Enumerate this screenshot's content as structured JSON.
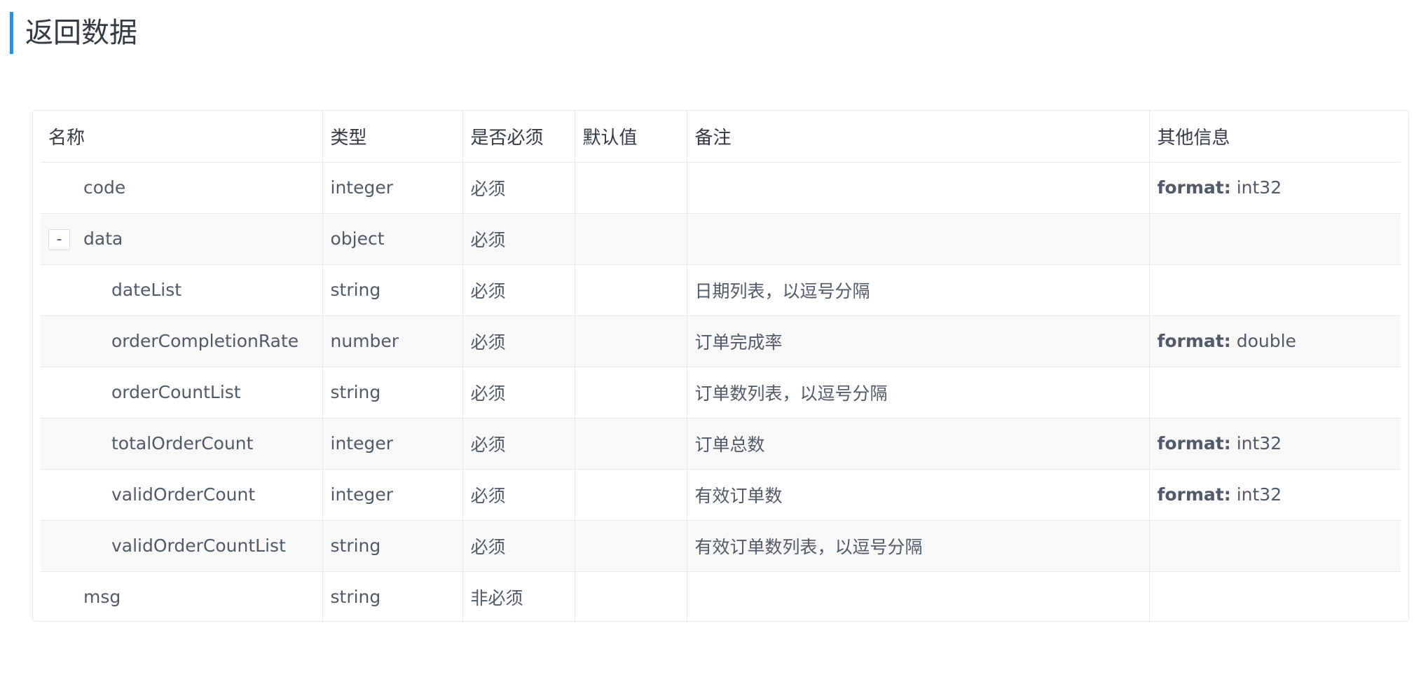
{
  "section": {
    "title": "返回数据"
  },
  "table": {
    "headers": {
      "name": "名称",
      "type": "类型",
      "required": "是否必须",
      "default": "默认值",
      "remark": "备注",
      "other": "其他信息"
    },
    "collapse_label": "-",
    "format_key": "format:",
    "rows": [
      {
        "name": "code",
        "type": "integer",
        "required": "必须",
        "default": "",
        "remark": "",
        "format": "int32"
      },
      {
        "name": "data",
        "type": "object",
        "required": "必须",
        "default": "",
        "remark": "",
        "format": ""
      },
      {
        "name": "dateList",
        "type": "string",
        "required": "必须",
        "default": "",
        "remark": "日期列表，以逗号分隔",
        "format": ""
      },
      {
        "name": "orderCompletionRate",
        "type": "number",
        "required": "必须",
        "default": "",
        "remark": "订单完成率",
        "format": "double"
      },
      {
        "name": "orderCountList",
        "type": "string",
        "required": "必须",
        "default": "",
        "remark": "订单数列表，以逗号分隔",
        "format": ""
      },
      {
        "name": "totalOrderCount",
        "type": "integer",
        "required": "必须",
        "default": "",
        "remark": "订单总数",
        "format": "int32"
      },
      {
        "name": "validOrderCount",
        "type": "integer",
        "required": "必须",
        "default": "",
        "remark": "有效订单数",
        "format": "int32"
      },
      {
        "name": "validOrderCountList",
        "type": "string",
        "required": "必须",
        "default": "",
        "remark": "有效订单数列表，以逗号分隔",
        "format": ""
      },
      {
        "name": "msg",
        "type": "string",
        "required": "非必须",
        "default": "",
        "remark": "",
        "format": ""
      }
    ]
  }
}
